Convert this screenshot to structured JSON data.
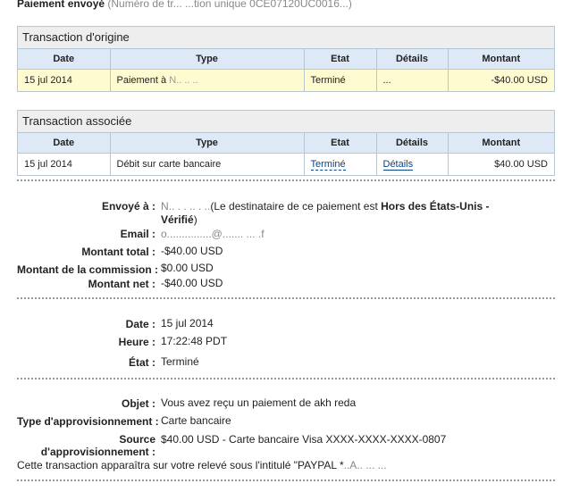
{
  "page": {
    "title": "Paiement envoyé",
    "title_redacted": "(Numéro de tr...       ...tion unique 0CE07120UC0016...)"
  },
  "columns": [
    "Date",
    "Type",
    "Etat",
    "Détails",
    "Montant"
  ],
  "origin": {
    "heading": "Transaction d'origine",
    "row": {
      "date": "15 jul 2014",
      "type": "Paiement à",
      "type_redacted": "N.. ..  ..",
      "status": "Terminé",
      "details": "...",
      "amount": "-$40.00 USD"
    }
  },
  "associated": {
    "heading": "Transaction associée",
    "row": {
      "date": "15 jul 2014",
      "type": "Débit sur carte bancaire",
      "status": "Terminé",
      "details": "Détails",
      "amount": "$40.00 USD"
    }
  },
  "summary": {
    "sent_to_label": "Envoyé à :",
    "sent_to_redacted": "N.. . . .. . ..",
    "sent_to_text_a": "(Le destinataire de ce paiement est ",
    "sent_to_bold": "Hors des États-Unis -",
    "sent_to_line2": "Vérifié",
    "sent_to_close": ")",
    "email_label": "Email :",
    "email_redacted": "o...............@....... ... .f",
    "total_label": "Montant total :",
    "total_value": "-$40.00 USD",
    "fee_label": "Montant de la commission :",
    "fee_value": "$0.00 USD",
    "net_label": "Montant net :",
    "net_value": "-$40.00 USD"
  },
  "timing": {
    "date_label": "Date :",
    "date_value": "15 jul 2014",
    "time_label": "Heure :",
    "time_value": "17:22:48 PDT",
    "state_label": "État :",
    "state_value": "Terminé"
  },
  "funding": {
    "subject_label": "Objet :",
    "subject_value": "Vous avez reçu un paiement de akh reda",
    "type_label": "Type d'approvisionnement :",
    "type_value": "Carte bancaire",
    "source_label_1": "Source",
    "source_label_2": "d'approvisionnement :",
    "source_value": "$40.00 USD - Carte bancaire Visa XXXX-XXXX-XXXX-0807",
    "note": "Cette transaction apparaîtra sur votre relevé sous l'intitulé \"PAYPAL *",
    "note_redacted": "..A..  ... ..."
  }
}
